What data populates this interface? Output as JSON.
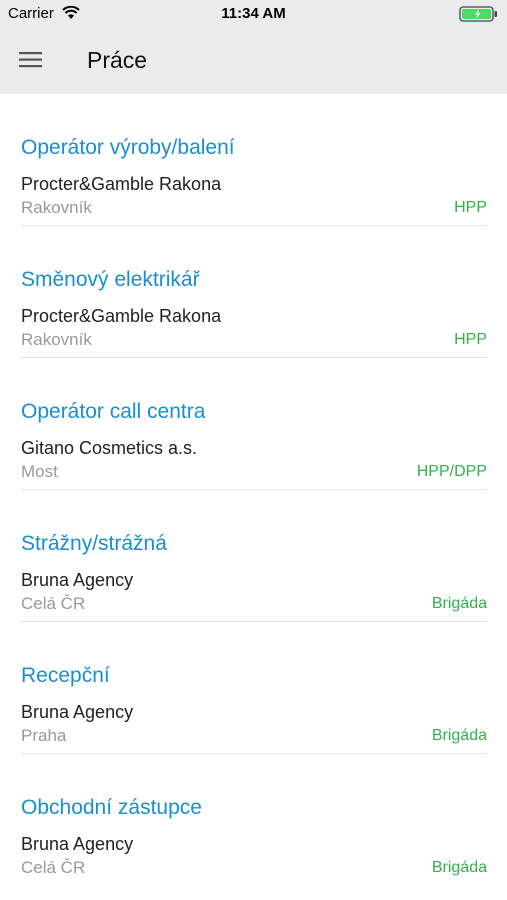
{
  "status_bar": {
    "carrier": "Carrier",
    "time": "11:34 AM"
  },
  "header": {
    "title": "Práce"
  },
  "jobs": [
    {
      "title": "Operátor výroby/balení",
      "company": "Procter&Gamble Rakona",
      "location": "Rakovník",
      "type": "HPP"
    },
    {
      "title": "Směnový elektrikář",
      "company": "Procter&Gamble Rakona",
      "location": "Rakovník",
      "type": "HPP"
    },
    {
      "title": "Operátor call centra",
      "company": "Gitano Cosmetics a.s.",
      "location": "Most",
      "type": "HPP/DPP"
    },
    {
      "title": "Strážny/strážná",
      "company": "Bruna Agency",
      "location": "Celá ČR",
      "type": "Brigáda"
    },
    {
      "title": "Recepční",
      "company": "Bruna Agency",
      "location": "Praha",
      "type": "Brigáda"
    },
    {
      "title": "Obchodní zástupce",
      "company": "Bruna Agency",
      "location": "Celá ČR",
      "type": "Brigáda"
    }
  ],
  "colors": {
    "title_blue": "#1a8fcf",
    "type_green": "#2fb34a",
    "header_bg": "#ebebeb"
  }
}
